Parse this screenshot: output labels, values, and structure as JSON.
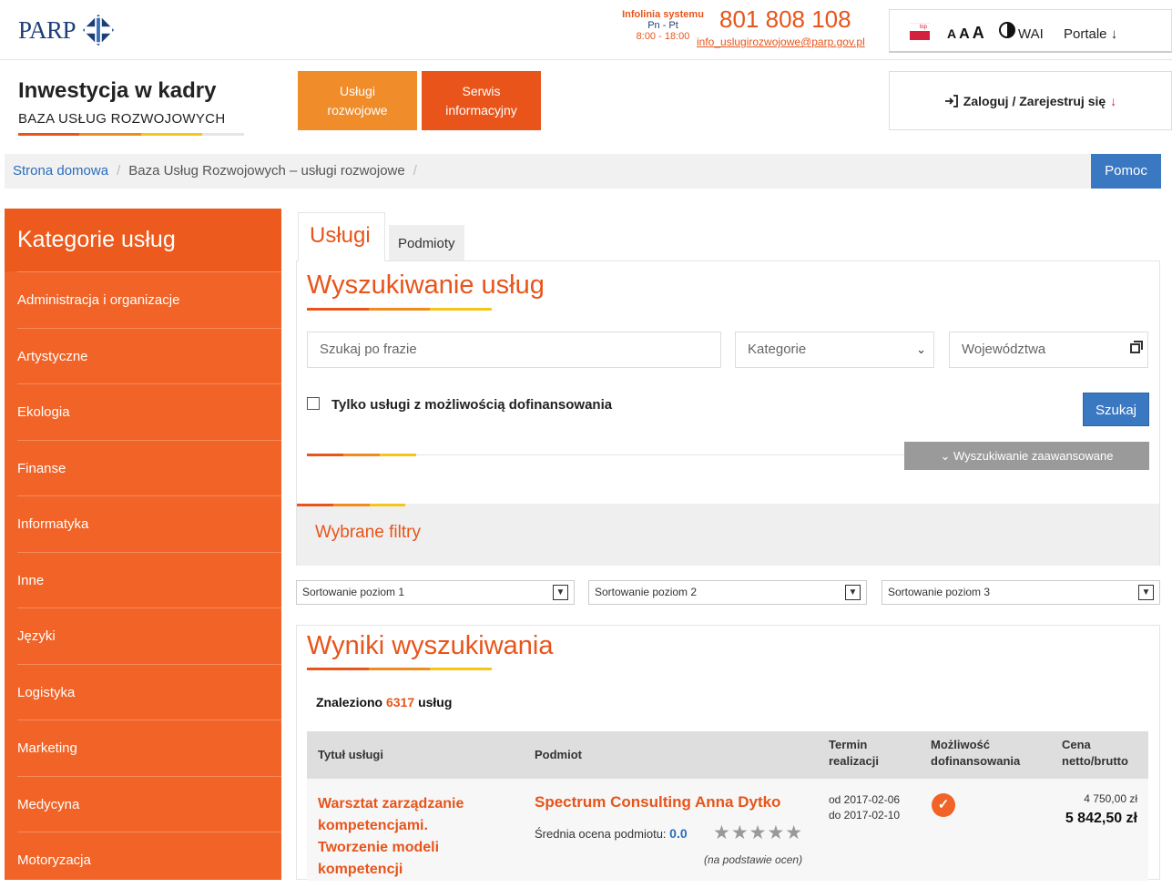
{
  "header": {
    "logo_text": "PARP",
    "infolinia_label": "Infolinia systemu",
    "infolinia_days": "Pn - Pt",
    "infolinia_hours": "8:00 - 18:00",
    "phone": "801 808 108",
    "email": "info_uslugirozwojowe@parp.gov.pl",
    "flag_text": "bip",
    "font_sizes": [
      "A",
      "A",
      "A"
    ],
    "wai_label": "WAI",
    "portale_label": "Portale ↓"
  },
  "brand": {
    "title": "Inwestycja w kadry",
    "subtitle": "BAZA USŁUG ROZWOJOWYCH"
  },
  "nav": {
    "uslugi_line1": "Usługi",
    "uslugi_line2": "rozwojowe",
    "serwis_line1": "Serwis",
    "serwis_line2": "informacyjny",
    "login_label": "Zaloguj / Zarejestruj się",
    "login_icon": "login-arrow-icon"
  },
  "breadcrumb": {
    "home": "Strona domowa",
    "current": "Baza Usług Rozwojowych – usługi rozwojowe",
    "sep": "/",
    "help_button": "Pomoc"
  },
  "sidebar": {
    "title": "Kategorie usług",
    "items": [
      "Administracja i organizacje",
      "Artystyczne",
      "Ekologia",
      "Finanse",
      "Informatyka",
      "Inne",
      "Języki",
      "Logistyka",
      "Marketing",
      "Medycyna",
      "Motoryzacja"
    ]
  },
  "tabs": {
    "uslugi": "Usługi",
    "podmioty": "Podmioty"
  },
  "search": {
    "title": "Wyszukiwanie usług",
    "phrase_placeholder": "Szukaj po frazie",
    "category_placeholder": "Kategorie",
    "region_placeholder": "Województwa",
    "checkbox_label": "Tylko usługi z możliwością dofinansowania",
    "search_button": "Szukaj",
    "advanced_button": "Wyszukiwanie zaawansowane",
    "filters_title": "Wybrane filtry"
  },
  "sorting": {
    "level1": "Sortowanie poziom 1",
    "level2": "Sortowanie poziom 2",
    "level3": "Sortowanie poziom 3"
  },
  "results": {
    "title": "Wyniki wyszukiwania",
    "found_prefix": "Znaleziono",
    "found_count": "6317",
    "found_suffix": "usług",
    "columns": {
      "title": "Tytuł usługi",
      "provider": "Podmiot",
      "term_line1": "Termin",
      "term_line2": "realizacji",
      "funding_line1": "Możliwość",
      "funding_line2": "dofinansowania",
      "price_line1": "Cena",
      "price_line2": "netto/brutto"
    },
    "rows": [
      {
        "title": "Warsztat zarządzanie kompetencjami. Tworzenie modeli kompetencji",
        "provider": "Spectrum Consulting Anna Dytko",
        "rating_label": "Średnia ocena podmiotu:",
        "rating_value": "0.0",
        "stars": "★★★★★",
        "rating_basis": "(na podstawie ocen)",
        "date_from": "od 2017-02-06",
        "date_to": "do 2017-02-10",
        "funding_available": true,
        "price_net": "4 750,00 zł",
        "price_gross": "5 842,50 zł"
      }
    ]
  },
  "colors": {
    "brand_orange": "#e8541a",
    "light_orange": "#f08c2a",
    "yellow": "#f5c518",
    "blue": "#3b78c2",
    "navy": "#1c3f7a"
  }
}
